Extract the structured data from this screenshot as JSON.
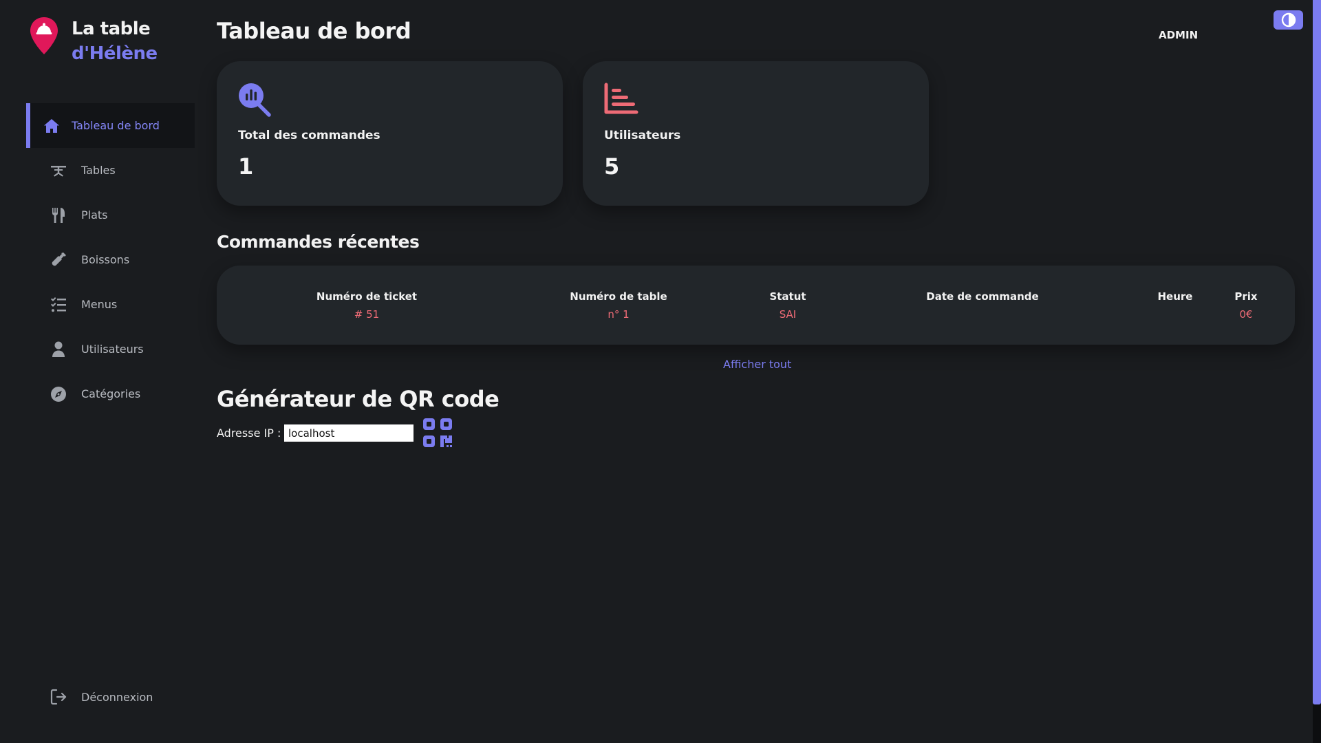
{
  "brand": {
    "line1": "La table",
    "line2": "d'Hélène"
  },
  "sidebar": {
    "items": [
      {
        "label": "Tableau de bord",
        "icon": "home-icon",
        "active": true
      },
      {
        "label": "Tables",
        "icon": "table-icon",
        "active": false
      },
      {
        "label": "Plats",
        "icon": "utensils-icon",
        "active": false
      },
      {
        "label": "Boissons",
        "icon": "bottle-icon",
        "active": false
      },
      {
        "label": "Menus",
        "icon": "list-check-icon",
        "active": false
      },
      {
        "label": "Utilisateurs",
        "icon": "user-icon",
        "active": false
      },
      {
        "label": "Catégories",
        "icon": "compass-icon",
        "active": false
      }
    ],
    "logout_label": "Déconnexion"
  },
  "header": {
    "title": "Tableau de bord",
    "user": "ADMIN"
  },
  "cards": [
    {
      "label": "Total des commandes",
      "value": "1",
      "icon": "chart-search-icon",
      "color": "#7b7cf0"
    },
    {
      "label": "Utilisateurs",
      "value": "5",
      "icon": "bar-chart-icon",
      "color": "#ee6b76"
    }
  ],
  "orders": {
    "title": "Commandes récentes",
    "columns": [
      "Numéro de ticket",
      "Numéro de table",
      "Statut",
      "Date de commande",
      "Heure",
      "Prix"
    ],
    "rows": [
      [
        "# 51",
        "n° 1",
        "SAI",
        "",
        "",
        "0€"
      ]
    ],
    "see_all": "Afficher tout"
  },
  "qr": {
    "title": "Générateur de QR code",
    "ip_label": "Adresse IP :",
    "ip_value": "localhost"
  },
  "colors": {
    "accent": "#7b7cf0",
    "danger": "#ee6b76",
    "background": "#1a1c1f",
    "card": "#22262a"
  }
}
